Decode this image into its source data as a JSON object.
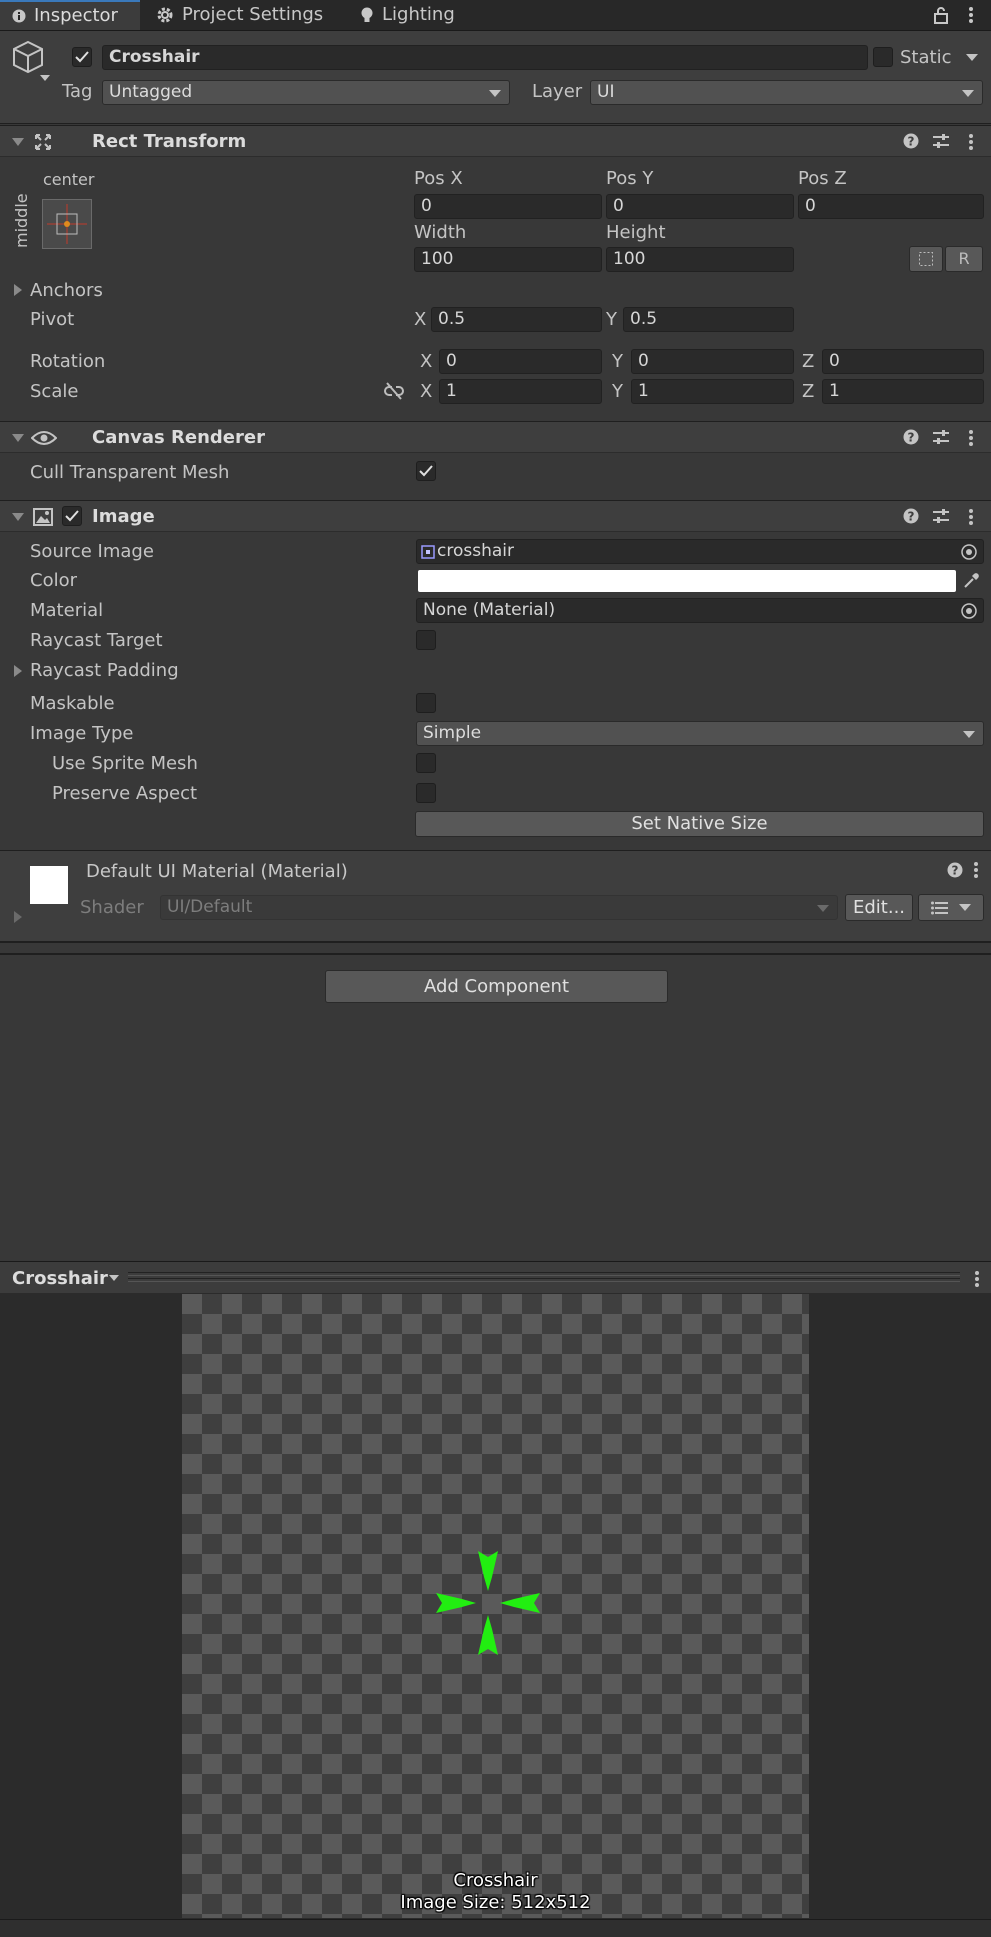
{
  "tabs": [
    {
      "label": "Inspector",
      "icon": "info-icon"
    },
    {
      "label": "Project Settings",
      "icon": "gear-icon"
    },
    {
      "label": "Lighting",
      "icon": "lightbulb-icon"
    }
  ],
  "header": {
    "name": "Crosshair",
    "static_label": "Static",
    "tag_label": "Tag",
    "tag_value": "Untagged",
    "layer_label": "Layer",
    "layer_value": "UI"
  },
  "rect_transform": {
    "title": "Rect Transform",
    "anchor_h": "center",
    "anchor_v": "middle",
    "posx_label": "Pos X",
    "posx": "0",
    "posy_label": "Pos Y",
    "posy": "0",
    "posz_label": "Pos Z",
    "posz": "0",
    "width_label": "Width",
    "width": "100",
    "height_label": "Height",
    "height": "100",
    "anchors_label": "Anchors",
    "pivot_label": "Pivot",
    "pivot_x": "0.5",
    "pivot_y": "0.5",
    "rotation_label": "Rotation",
    "rot_x": "0",
    "rot_y": "0",
    "rot_z": "0",
    "scale_label": "Scale",
    "scale_x": "1",
    "scale_y": "1",
    "scale_z": "1",
    "x": "X",
    "y": "Y",
    "z": "Z",
    "r_button": "R"
  },
  "canvas_renderer": {
    "title": "Canvas Renderer",
    "cull_label": "Cull Transparent Mesh"
  },
  "image": {
    "title": "Image",
    "source_label": "Source Image",
    "source_value": "crosshair",
    "color_label": "Color",
    "color_value": "#ffffff",
    "material_label": "Material",
    "material_value": "None (Material)",
    "raycast_label": "Raycast Target",
    "raycast_padding_label": "Raycast Padding",
    "maskable_label": "Maskable",
    "image_type_label": "Image Type",
    "image_type_value": "Simple",
    "use_sprite_label": "Use Sprite Mesh",
    "preserve_label": "Preserve Aspect",
    "native_button": "Set Native Size"
  },
  "material": {
    "title": "Default UI Material (Material)",
    "shader_label": "Shader",
    "shader_value": "UI/Default",
    "edit_button": "Edit..."
  },
  "add_component": "Add Component",
  "preview": {
    "title": "Crosshair",
    "caption_name": "Crosshair",
    "caption_size": "Image Size: 512x512",
    "crosshair_color": "#22ee11"
  }
}
